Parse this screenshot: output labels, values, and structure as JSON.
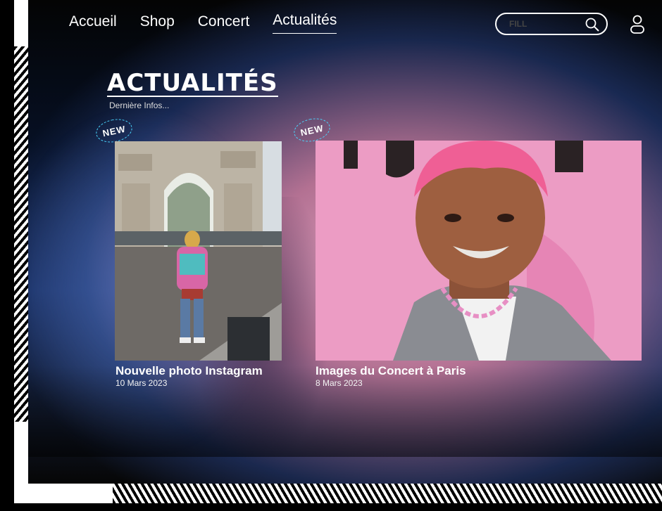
{
  "nav": {
    "items": [
      {
        "label": "Accueil"
      },
      {
        "label": "Shop"
      },
      {
        "label": "Concert"
      },
      {
        "label": "Actualités"
      }
    ]
  },
  "search": {
    "placeholder": "FILL"
  },
  "page": {
    "title": "ACTUALITÉS",
    "subtitle": "Dernière Infos..."
  },
  "badge": {
    "text": "NEW"
  },
  "cards": [
    {
      "title": "Nouvelle photo Instagram",
      "date": "10 Mars 2023"
    },
    {
      "title": "Images du Concert à Paris",
      "date": "8 Mars 2023"
    }
  ],
  "colors": {
    "accent_pink": "#e04fd0",
    "accent_cyan": "#35d6ff",
    "bg_pink": "#eca9c4",
    "bg_blue": "#193063"
  },
  "icons": {
    "search": "search-icon",
    "user": "user-icon"
  }
}
